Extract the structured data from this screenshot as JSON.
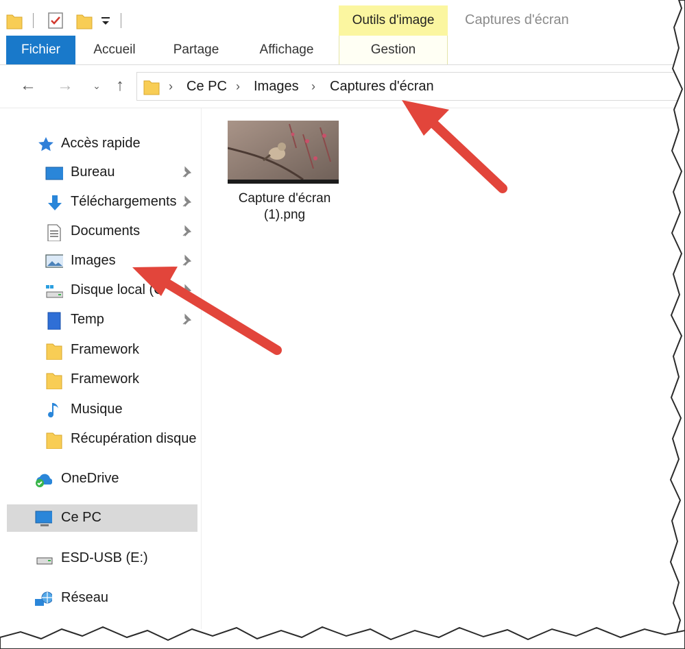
{
  "ribbon": {
    "context_group": "Outils d'image",
    "window_title": "Captures d'écran",
    "tabs": {
      "file": "Fichier",
      "home": "Accueil",
      "share": "Partage",
      "view": "Affichage",
      "manage": "Gestion"
    }
  },
  "address": {
    "crumbs": [
      "Ce PC",
      "Images",
      "Captures d'écran"
    ]
  },
  "nav": {
    "quick_access": "Accès rapide",
    "items": [
      {
        "label": "Bureau",
        "icon": "desktop-icon",
        "pinned": true
      },
      {
        "label": "Téléchargements",
        "icon": "download-arrow-icon",
        "pinned": true
      },
      {
        "label": "Documents",
        "icon": "document-icon",
        "pinned": true
      },
      {
        "label": "Images",
        "icon": "pictures-icon",
        "pinned": true
      },
      {
        "label": "Disque local (C",
        "icon": "local-disk-icon",
        "pinned": true
      },
      {
        "label": "Temp",
        "icon": "drive-icon",
        "pinned": true
      },
      {
        "label": "Framework",
        "icon": "folder-icon",
        "pinned": false
      },
      {
        "label": "Framework",
        "icon": "folder-icon",
        "pinned": false
      },
      {
        "label": "Musique",
        "icon": "music-note-icon",
        "pinned": false
      },
      {
        "label": "Récupération disque",
        "icon": "folder-icon",
        "pinned": false
      }
    ],
    "onedrive": "OneDrive",
    "this_pc": "Ce PC",
    "usb": "ESD-USB (E:)",
    "network": "Réseau"
  },
  "content": {
    "files": [
      {
        "name_line1": "Capture d'écran",
        "name_line2": "(1).png"
      }
    ]
  },
  "colors": {
    "file_tab": "#1979ca",
    "context_tab": "#fbf6a0",
    "selected_nav": "#d9d9d9",
    "annotation_arrow": "#e2453b"
  }
}
